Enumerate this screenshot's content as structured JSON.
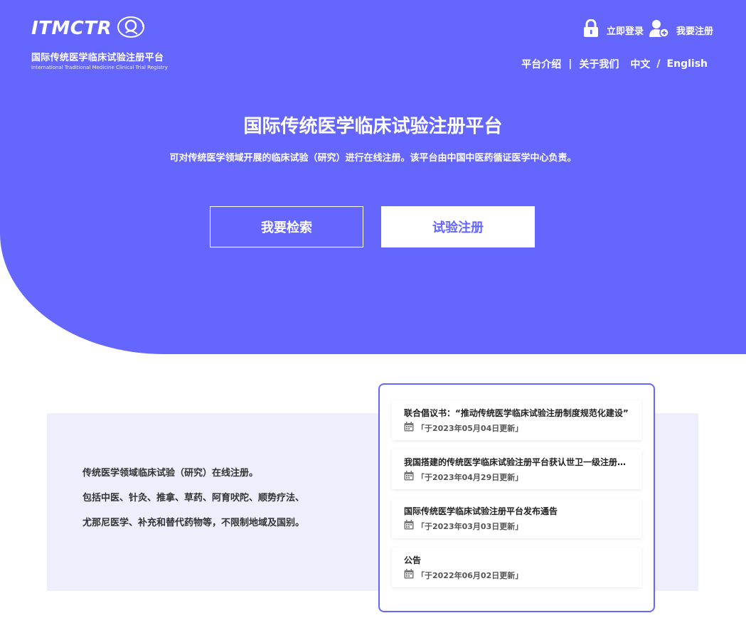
{
  "brand": {
    "logo_text": "ITMCTR",
    "name_cn": "国际传统医学临床试验注册平台",
    "name_en": "International Traditional Medicine Clinical Trial Registry"
  },
  "header": {
    "login_label": "立即登录",
    "signup_label": "我要注册",
    "nav": {
      "intro": "平台介绍",
      "sep1": "|",
      "about": "关于我们",
      "lang_cn": "中文",
      "sep2": "/",
      "lang_en": "English"
    }
  },
  "hero": {
    "title": "国际传统医学临床试验注册平台",
    "subtitle": "可对传统医学领域开展的临床试验（研究）进行在线注册。该平台由中国中医药循证医学中心负责。",
    "search_button": "我要检索",
    "register_button": "试验注册"
  },
  "info": {
    "lines": [
      "传统医学领域临床试验（研究）在线注册。",
      "包括中医、针灸、推拿、草药、阿育吠陀、顺势疗法、",
      "尤那尼医学、补充和替代药物等，不限制地域及国别。"
    ]
  },
  "news": {
    "items": [
      {
        "title": "联合倡议书：“推动传统医学临床试验注册制度规范化建设”",
        "date": "「于2023年05月04日更新」"
      },
      {
        "title": "我国搭建的传统医学临床试验注册平台获认世卫一级注册机构",
        "date": "「于2023年04月29日更新」"
      },
      {
        "title": "国际传统医学临床试验注册平台发布通告",
        "date": "「于2023年03月03日更新」"
      },
      {
        "title": "公告",
        "date": "「于2022年06月02日更新」"
      }
    ]
  },
  "colors": {
    "primary": "#6466fd",
    "panel_bg": "#eeeefd"
  },
  "icons": [
    "lock-icon",
    "add-user-icon",
    "calendar-icon",
    "logo-mark-icon"
  ]
}
